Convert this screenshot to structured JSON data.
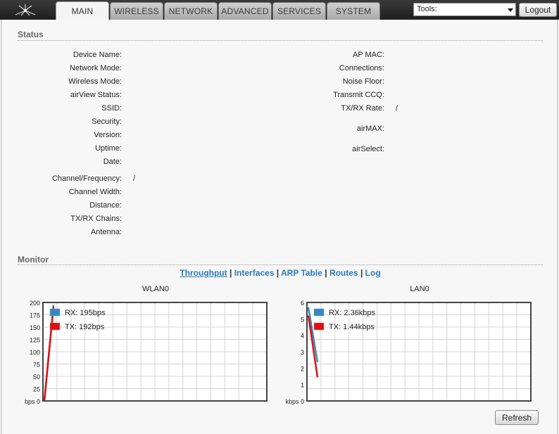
{
  "header": {
    "tabs": [
      {
        "label": "MAIN",
        "active": true
      },
      {
        "label": "WIRELESS",
        "active": false
      },
      {
        "label": "NETWORK",
        "active": false
      },
      {
        "label": "ADVANCED",
        "active": false
      },
      {
        "label": "SERVICES",
        "active": false
      },
      {
        "label": "SYSTEM",
        "active": false
      }
    ],
    "tools_select": {
      "value": "Tools:"
    },
    "logout_label": "Logout",
    "logo_icon": "ubiquiti-logo-icon"
  },
  "status": {
    "title": "Status",
    "left": [
      {
        "label": "Device Name:",
        "value": ""
      },
      {
        "label": "Network Mode:",
        "value": ""
      },
      {
        "label": "Wireless Mode:",
        "value": ""
      },
      {
        "label": "airView Status:",
        "value": ""
      },
      {
        "label": "SSID:",
        "value": ""
      },
      {
        "label": "Security:",
        "value": ""
      },
      {
        "label": "Version:",
        "value": ""
      },
      {
        "label": "Uptime:",
        "value": ""
      },
      {
        "label": "Date:",
        "value": ""
      },
      {
        "label": "Channel/Frequency:",
        "value": "/"
      },
      {
        "label": "Channel Width:",
        "value": ""
      },
      {
        "label": "Distance:",
        "value": ""
      },
      {
        "label": "TX/RX Chains:",
        "value": ""
      },
      {
        "label": "Antenna:",
        "value": ""
      }
    ],
    "right": [
      {
        "label": "AP MAC:",
        "value": ""
      },
      {
        "label": "Connections:",
        "value": ""
      },
      {
        "label": "Noise Floor:",
        "value": ""
      },
      {
        "label": "Transmit CCQ:",
        "value": ""
      },
      {
        "label": "TX/RX Rate:",
        "value": "/"
      },
      {
        "label": "airMAX:",
        "value": ""
      },
      {
        "label": "airSelect:",
        "value": ""
      }
    ]
  },
  "monitor": {
    "title": "Monitor",
    "links": [
      "Throughput",
      "Interfaces",
      "ARP Table",
      "Routes",
      "Log"
    ],
    "separator": "|",
    "refresh_label": "Refresh"
  },
  "colors": {
    "rx": "#2f8ac6",
    "tx": "#e01010",
    "link": "#2a7ab8"
  },
  "chart_data": [
    {
      "type": "line",
      "title": "WLAN0",
      "ylim": [
        0,
        200
      ],
      "yticks": [
        0,
        25,
        50,
        75,
        100,
        125,
        150,
        175,
        200
      ],
      "ytick_labels": [
        "bps 0",
        "25",
        "50",
        "75",
        "100",
        "125",
        "150",
        "175",
        "200"
      ],
      "grid": true,
      "legend": "top-left",
      "series": [
        {
          "name": "RX: 195bps",
          "color": "#2f8ac6",
          "values": [
            0,
            195
          ]
        },
        {
          "name": "TX: 192bps",
          "color": "#e01010",
          "values": [
            0,
            192
          ]
        }
      ]
    },
    {
      "type": "line",
      "title": "LAN0",
      "ylim": [
        0,
        6
      ],
      "yticks": [
        0,
        1,
        2,
        3,
        4,
        5,
        6
      ],
      "ytick_labels": [
        "kbps 0",
        "1",
        "2",
        "3",
        "4",
        "5",
        "6"
      ],
      "grid": true,
      "legend": "top-left",
      "series": [
        {
          "name": "RX: 2.36kbps",
          "color": "#2f8ac6",
          "values": [
            5.7,
            2.36
          ]
        },
        {
          "name": "TX: 1.44kbps",
          "color": "#e01010",
          "values": [
            5.2,
            1.44
          ]
        }
      ]
    }
  ]
}
